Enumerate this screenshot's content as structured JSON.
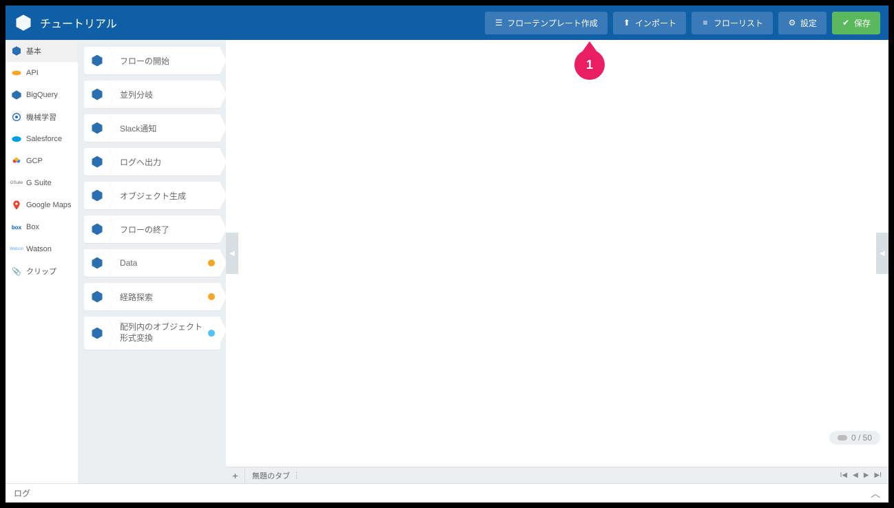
{
  "header": {
    "title": "チュートリアル",
    "buttons": {
      "create_template": "フローテンプレート作成",
      "import": "インポート",
      "flow_list": "フローリスト",
      "settings": "設定",
      "save": "保存"
    }
  },
  "sidebar": {
    "categories": [
      {
        "label": "基本",
        "icon": "box",
        "active": true
      },
      {
        "label": "API",
        "icon": "api"
      },
      {
        "label": "BigQuery",
        "icon": "bigquery"
      },
      {
        "label": "機械学習",
        "icon": "ml"
      },
      {
        "label": "Salesforce",
        "icon": "salesforce"
      },
      {
        "label": "GCP",
        "icon": "gcp"
      },
      {
        "label": "G Suite",
        "icon": "gsuite"
      },
      {
        "label": "Google Maps",
        "icon": "maps"
      },
      {
        "label": "Box",
        "icon": "box-brand"
      },
      {
        "label": "Watson",
        "icon": "watson"
      },
      {
        "label": "クリップ",
        "icon": "clip"
      }
    ]
  },
  "palette": {
    "blocks": [
      {
        "label": "フローの開始"
      },
      {
        "label": "並列分岐"
      },
      {
        "label": "Slack通知"
      },
      {
        "label": "ログへ出力"
      },
      {
        "label": "オブジェクト生成"
      },
      {
        "label": "フローの終了"
      },
      {
        "label": "Data",
        "badge": "orange"
      },
      {
        "label": "経路探索",
        "badge": "orange"
      },
      {
        "label": "配列内のオブジェクト形式変換",
        "badge": "blue"
      }
    ]
  },
  "canvas": {
    "hint_number": "1",
    "counter": "0 / 50"
  },
  "tabbar": {
    "tab_label": "無題のタブ"
  },
  "logbar": {
    "label": "ログ"
  }
}
